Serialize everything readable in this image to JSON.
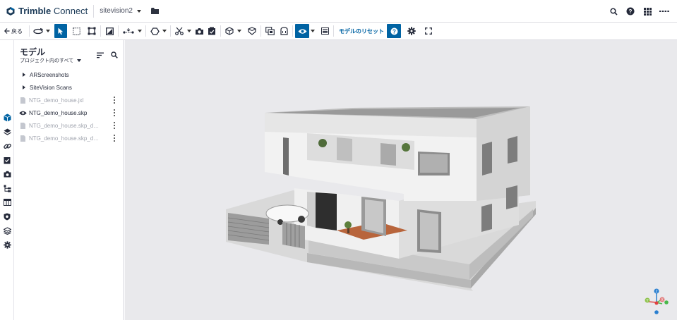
{
  "app": {
    "brand_bold": "Trimble",
    "brand_light": " Connect",
    "project_name": "sitevision2"
  },
  "toolbar": {
    "back_label": "戻る",
    "reset_label": "モデルのリセット"
  },
  "panel": {
    "title": "モデル",
    "filter_label": "プロジェクト内のすべて",
    "items": [
      {
        "label": "ARScreenshots",
        "kind": "folder"
      },
      {
        "label": "SiteVision Scans",
        "kind": "folder"
      },
      {
        "label": "NTG_demo_house.jxl",
        "kind": "file-dim"
      },
      {
        "label": "NTG_demo_house.skp",
        "kind": "file-visible"
      },
      {
        "label": "NTG_demo_house.skp_demo...",
        "kind": "file-dim"
      },
      {
        "label": "NTG_demo_house.skp_demo...",
        "kind": "file-dim"
      }
    ]
  },
  "viewcube": {
    "z": "Z",
    "x": "X",
    "y": "Y"
  },
  "colors": {
    "accent": "#0063a3",
    "brand_navy": "#1b3a57",
    "viewer_bg": "#e9e9ec"
  }
}
